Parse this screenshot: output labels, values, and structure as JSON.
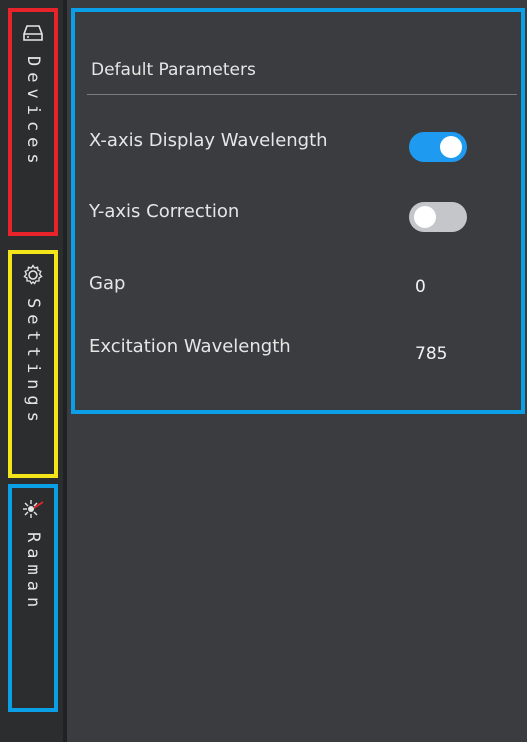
{
  "sidebar": {
    "tabs": [
      {
        "label": "Devices",
        "icon": "device-icon",
        "highlight": "#e8232a"
      },
      {
        "label": "Settings",
        "icon": "gear-icon",
        "highlight": "#f4e51a"
      },
      {
        "label": "Raman",
        "icon": "laser-icon",
        "highlight": "#0a9fe6"
      }
    ]
  },
  "panel": {
    "title": "Default Parameters",
    "highlight": "#0a9fe6",
    "rows": [
      {
        "label": "X-axis Display Wavelength",
        "type": "toggle",
        "enabled": true
      },
      {
        "label": "Y-axis Correction",
        "type": "toggle",
        "enabled": false
      },
      {
        "label": "Gap",
        "type": "value",
        "value": "0"
      },
      {
        "label": "Excitation Wavelength",
        "type": "value",
        "value": "785"
      }
    ]
  },
  "colors": {
    "accent": "#1e9bf0",
    "background": "#3a3c3f",
    "sidebar": "#2b2d2f"
  }
}
